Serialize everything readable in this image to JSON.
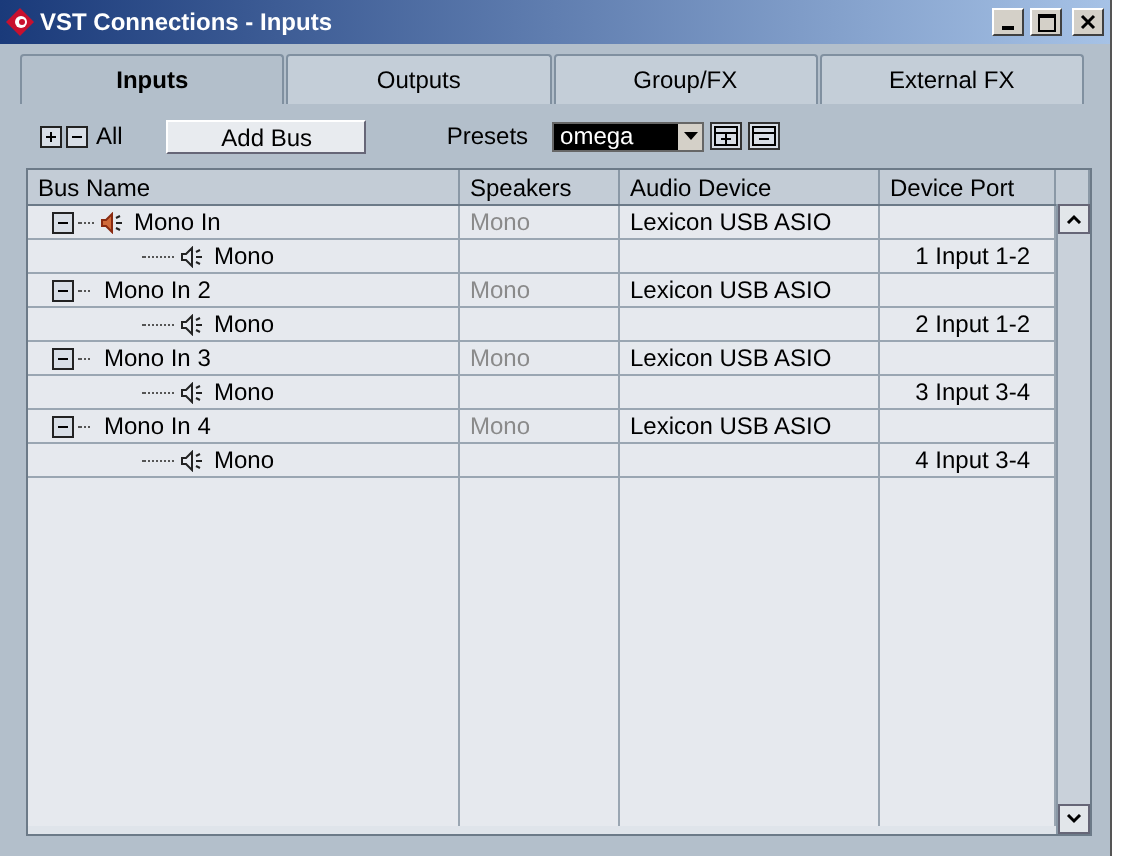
{
  "window": {
    "title": "VST Connections - Inputs"
  },
  "tabs": [
    {
      "label": "Inputs",
      "selected": true
    },
    {
      "label": "Outputs",
      "selected": false
    },
    {
      "label": "Group/FX",
      "selected": false
    },
    {
      "label": "External FX",
      "selected": false
    }
  ],
  "toolbar": {
    "all_label": "All",
    "add_bus": "Add Bus",
    "presets_label": "Presets",
    "preset_value": "omega"
  },
  "table": {
    "columns": [
      "Bus Name",
      "Speakers",
      "Audio Device",
      "Device Port"
    ],
    "buses": [
      {
        "name": "Mono In",
        "speakers": "Mono",
        "device": "Lexicon USB ASIO",
        "expanded": true,
        "active": true,
        "children": [
          {
            "name": "Mono",
            "port": "1 Input 1-2"
          }
        ]
      },
      {
        "name": "Mono In 2",
        "speakers": "Mono",
        "device": "Lexicon USB ASIO",
        "expanded": true,
        "active": false,
        "children": [
          {
            "name": "Mono",
            "port": "2 Input 1-2"
          }
        ]
      },
      {
        "name": "Mono In 3",
        "speakers": "Mono",
        "device": "Lexicon USB ASIO",
        "expanded": true,
        "active": false,
        "children": [
          {
            "name": "Mono",
            "port": "3 Input 3-4"
          }
        ]
      },
      {
        "name": "Mono In 4",
        "speakers": "Mono",
        "device": "Lexicon USB ASIO",
        "expanded": true,
        "active": false,
        "children": [
          {
            "name": "Mono",
            "port": "4 Input 3-4"
          }
        ]
      }
    ]
  }
}
